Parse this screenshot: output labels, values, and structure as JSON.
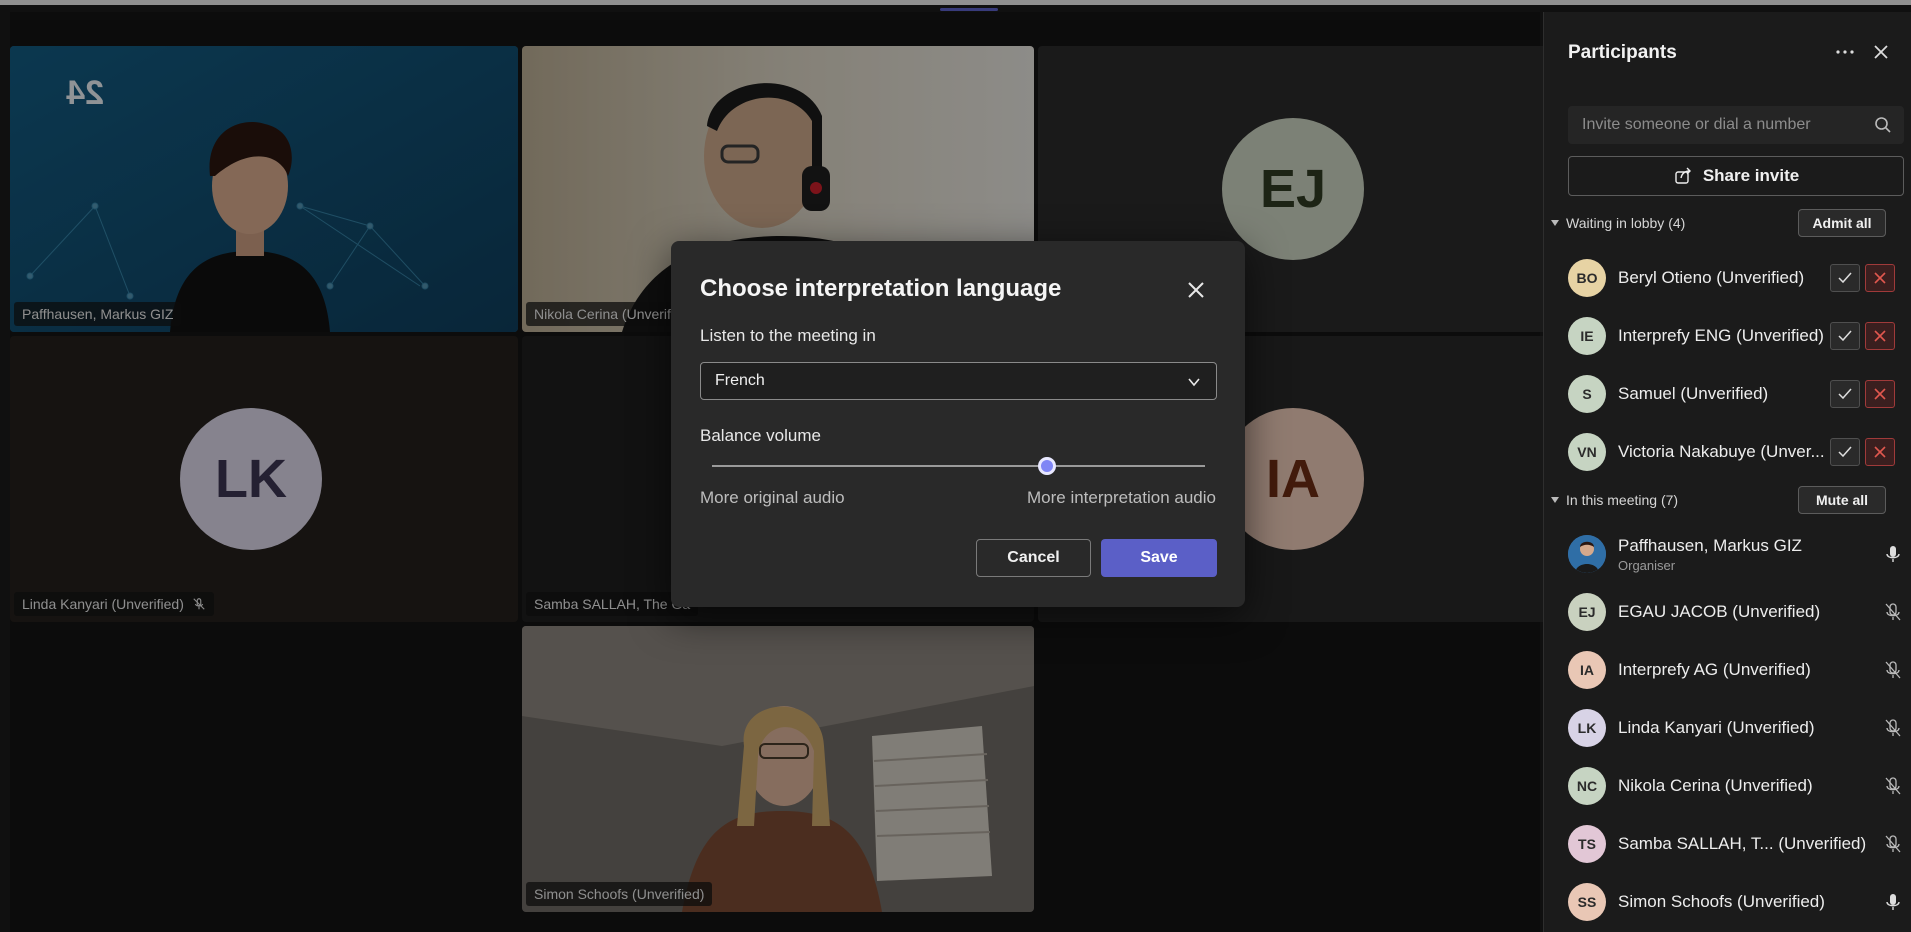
{
  "stage": {
    "tiles": [
      {
        "id": "paffhausen",
        "name": "Paffhausen, Markus GIZ",
        "kind": "video"
      },
      {
        "id": "nikola",
        "name": "Nikola Cerina (Unverifi",
        "kind": "video"
      },
      {
        "id": "egau",
        "name": "",
        "kind": "avatar",
        "initials": "EJ",
        "color": "#c9d1bf",
        "text_color": "#2f3a22"
      },
      {
        "id": "linda",
        "name": "Linda Kanyari (Unverified)",
        "kind": "avatar",
        "initials": "LK",
        "color": "#d8d3e6",
        "text_color": "#3b3452",
        "muted": true
      },
      {
        "id": "samba",
        "name": "Samba SALLAH, The Ga",
        "kind": "dark"
      },
      {
        "id": "interprefy",
        "name": "",
        "kind": "avatar",
        "initials": "IA",
        "color": "#e9c7b5",
        "text_color": "#6b2d14"
      },
      {
        "id": "simon",
        "name": "Simon Schoofs (Unverified)",
        "kind": "video"
      }
    ],
    "logo_text": "24"
  },
  "dialog": {
    "title": "Choose interpretation language",
    "listen_label": "Listen to the meeting in",
    "language_selected": "French",
    "balance_label": "Balance volume",
    "balance_value": 0.68,
    "left_label": "More original audio",
    "right_label": "More interpretation audio",
    "cancel_label": "Cancel",
    "save_label": "Save",
    "accent": "#5b5fc7"
  },
  "panel": {
    "title": "Participants",
    "invite_placeholder": "Invite someone or dial a number",
    "share_label": "Share invite",
    "lobby": {
      "header": "Waiting in lobby (4)",
      "action": "Admit all",
      "people": [
        {
          "initials": "BO",
          "name": "Beryl Otieno (Unverified)",
          "color": "#e7d3a4"
        },
        {
          "initials": "IE",
          "name": "Interprefy ENG (Unverified)",
          "color": "#c6d4c2"
        },
        {
          "initials": "S",
          "name": "Samuel (Unverified)",
          "color": "#c6d4c2"
        },
        {
          "initials": "VN",
          "name": "Victoria Nakabuye (Unver...",
          "color": "#c6d4c2"
        }
      ]
    },
    "meeting": {
      "header": "In this meeting (7)",
      "action": "Mute all",
      "people": [
        {
          "initials": "",
          "name": "Paffhausen, Markus GIZ",
          "sub": "Organiser",
          "color": "#3b6fa8",
          "photo": true,
          "mic": "on"
        },
        {
          "initials": "EJ",
          "name": "EGAU JACOB (Unverified)",
          "color": "#c9d1bf",
          "mic": "off"
        },
        {
          "initials": "IA",
          "name": "Interprefy AG (Unverified)",
          "color": "#e9c7b5",
          "mic": "off"
        },
        {
          "initials": "LK",
          "name": "Linda Kanyari (Unverified)",
          "color": "#d8d3e6",
          "mic": "off"
        },
        {
          "initials": "NC",
          "name": "Nikola Cerina (Unverified)",
          "color": "#c6d4c2",
          "mic": "off"
        },
        {
          "initials": "TS",
          "name": "Samba SALLAH, T...  (Unverified)",
          "color": "#e2c7d6",
          "mic": "off"
        },
        {
          "initials": "SS",
          "name": "Simon Schoofs (Unverified)",
          "color": "#e9c7b5",
          "mic": "on"
        }
      ]
    }
  }
}
